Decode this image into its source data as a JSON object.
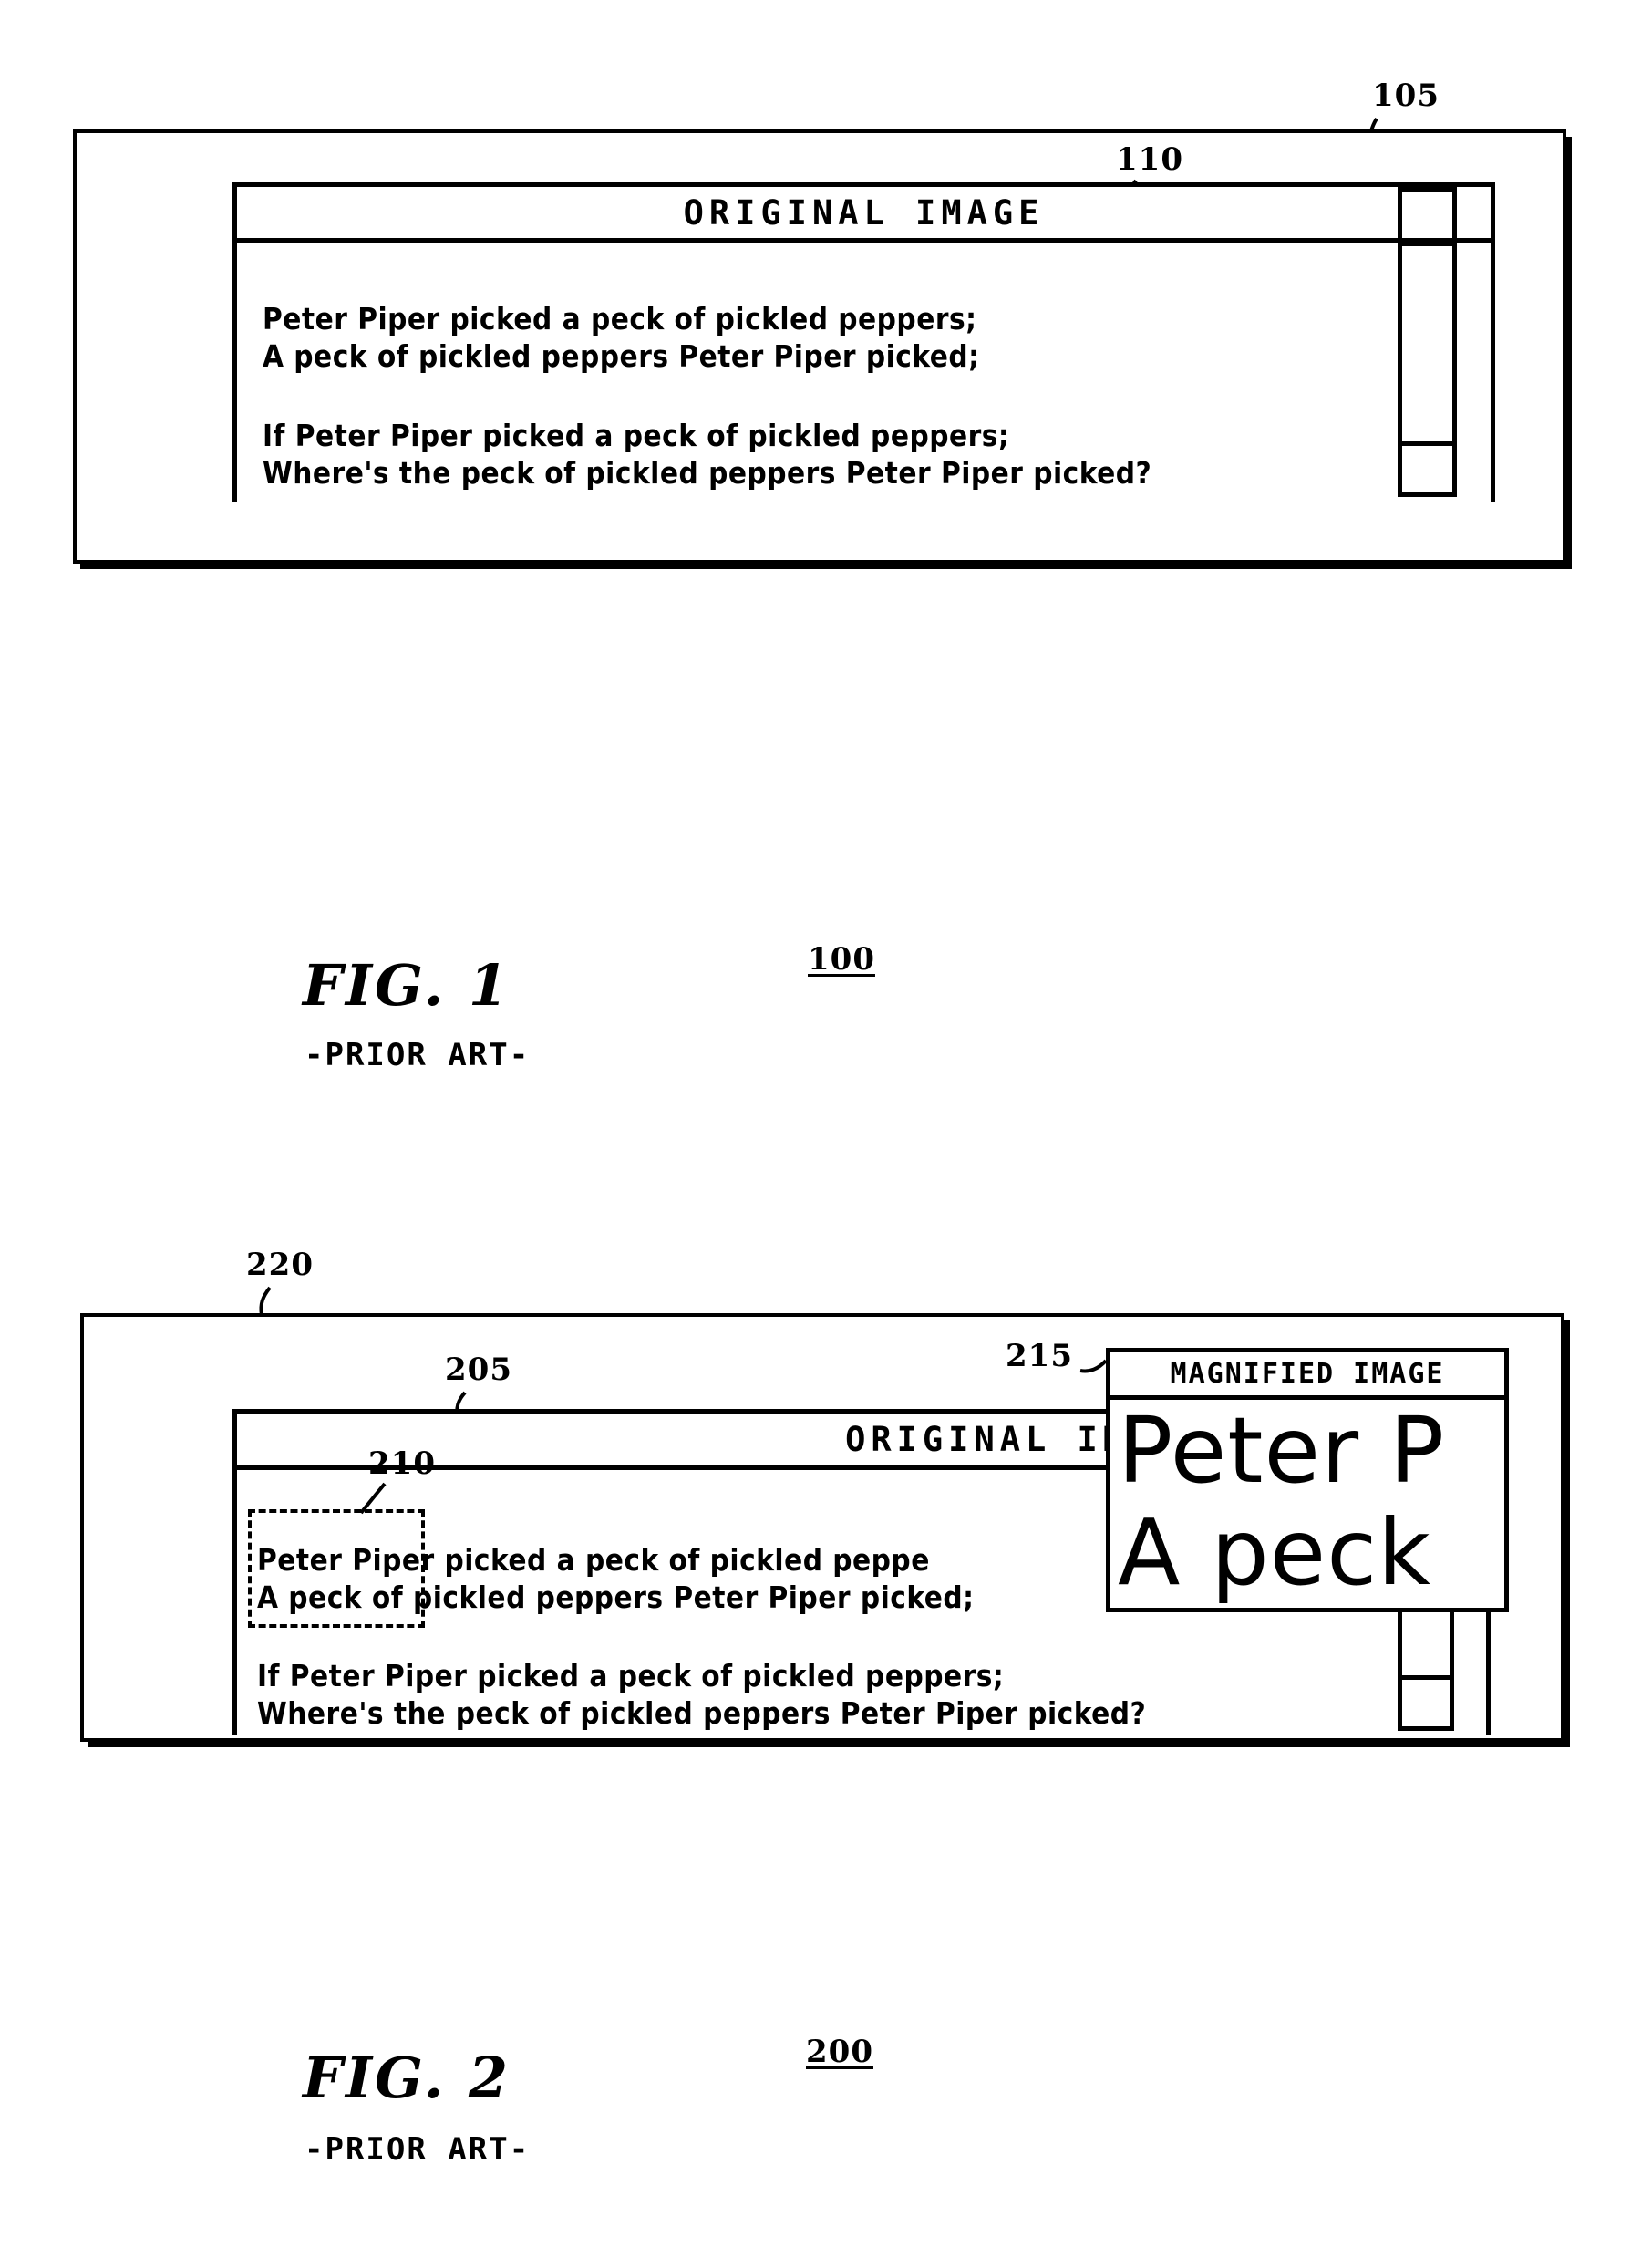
{
  "page": {
    "background_color": "#ffffff",
    "ink_color": "#000000"
  },
  "figures": [
    {
      "id": "fig1",
      "caption": "FIG. 1",
      "subcaption": "-PRIOR ART-",
      "figure_number": "100",
      "callouts": [
        {
          "id": "105",
          "label": "105",
          "target": "device-frame"
        },
        {
          "id": "110",
          "label": "110",
          "target": "original-image-window"
        }
      ],
      "window": {
        "title": "ORIGINAL IMAGE",
        "text_block_1": [
          "Peter Piper picked a peck of pickled peppers;",
          "A peck of pickled peppers Peter Piper picked;"
        ],
        "text_block_2": [
          "If Peter Piper picked a peck of pickled peppers;",
          "Where's the peck of pickled peppers Peter Piper picked?"
        ],
        "scrollbar": {
          "up_arrow": "",
          "down_arrow": "",
          "thumb": ""
        }
      }
    },
    {
      "id": "fig2",
      "caption": "FIG. 2",
      "subcaption": "-PRIOR ART-",
      "figure_number": "200",
      "callouts": [
        {
          "id": "220",
          "label": "220",
          "target": "device-frame"
        },
        {
          "id": "205",
          "label": "205",
          "target": "original-image-window"
        },
        {
          "id": "210",
          "label": "210",
          "target": "selection-marquee"
        },
        {
          "id": "215",
          "label": "215",
          "target": "magnified-image-window"
        }
      ],
      "window": {
        "title": "ORIGINAL IMAGE",
        "text_block_1": [
          "Peter Piper picked a peck of pickled peppe",
          "A peck of pickled peppers Peter Piper picked;"
        ],
        "text_block_2": [
          "If Peter Piper picked a peck of pickled peppers;",
          "Where's the peck of pickled peppers Peter Piper picked?"
        ],
        "scrollbar": {
          "up_arrow": "",
          "down_arrow": "",
          "thumb": ""
        }
      },
      "magnified_window": {
        "title": "MAGNIFIED IMAGE",
        "lines": [
          "Peter P",
          "A peck"
        ]
      },
      "selection": {
        "lines": [
          "Peter Piper",
          "A peck"
        ]
      }
    }
  ]
}
